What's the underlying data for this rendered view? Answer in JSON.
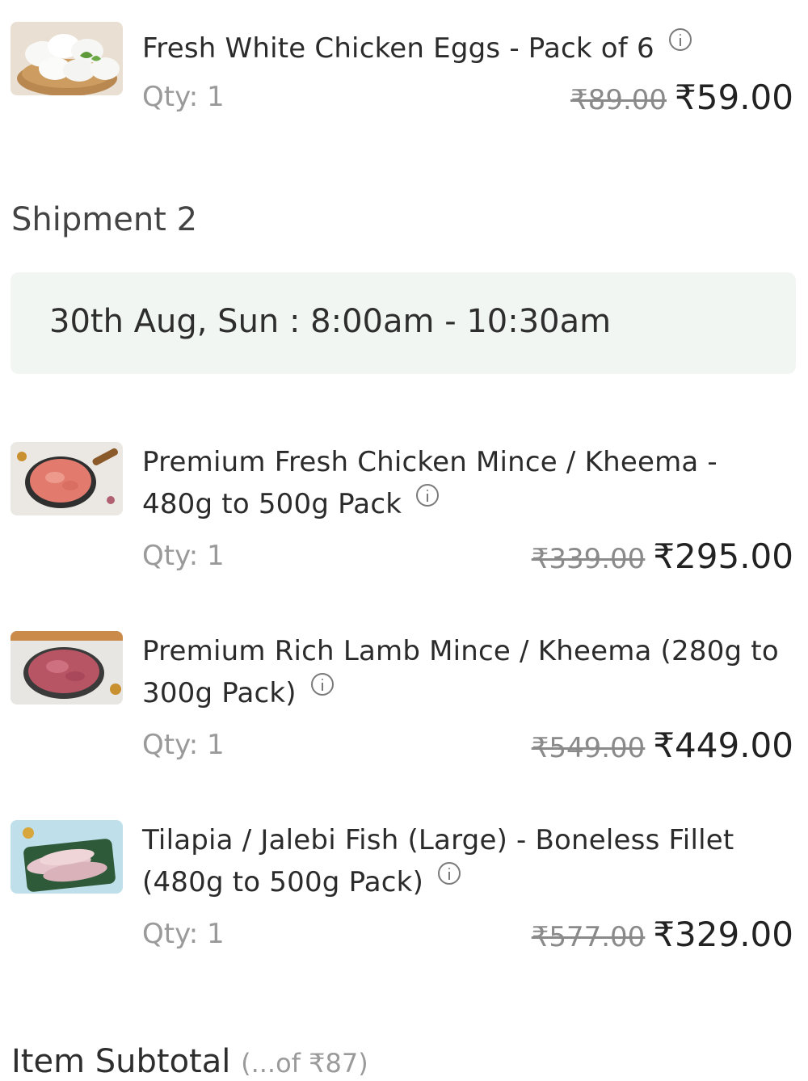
{
  "shipment1": {
    "items": [
      {
        "name": "Fresh White Chicken Eggs - Pack of 6",
        "qty": "Qty: 1",
        "mrp": "₹89.00",
        "price": "₹59.00",
        "image": "eggs-image"
      }
    ]
  },
  "shipment2": {
    "title": "Shipment 2",
    "slot": "30th Aug, Sun : 8:00am - 10:30am",
    "items": [
      {
        "name": "Premium Fresh Chicken Mince / Kheema - 480g to 500g Pack",
        "qty": "Qty: 1",
        "mrp": "₹339.00",
        "price": "₹295.00",
        "image": "chicken-mince-image"
      },
      {
        "name": "Premium Rich Lamb Mince / Kheema (280g to 300g Pack)",
        "qty": "Qty: 1",
        "mrp": "₹549.00",
        "price": "₹449.00",
        "image": "lamb-mince-image"
      },
      {
        "name": "Tilapia / Jalebi Fish (Large) - Boneless Fillet (480g to 500g Pack)",
        "qty": "Qty: 1",
        "mrp": "₹577.00",
        "price": "₹329.00",
        "image": "fish-fillet-image"
      }
    ]
  },
  "footer": {
    "item_subtotal_label": "Item Subtotal",
    "item_subtotal_note": "(...of ₹87)"
  },
  "colors": {
    "slot_bg": "#f2f6f3",
    "muted_text": "#9a9a9a",
    "strike_text": "#8a8a8a"
  },
  "icons": {
    "info": "info-icon"
  }
}
